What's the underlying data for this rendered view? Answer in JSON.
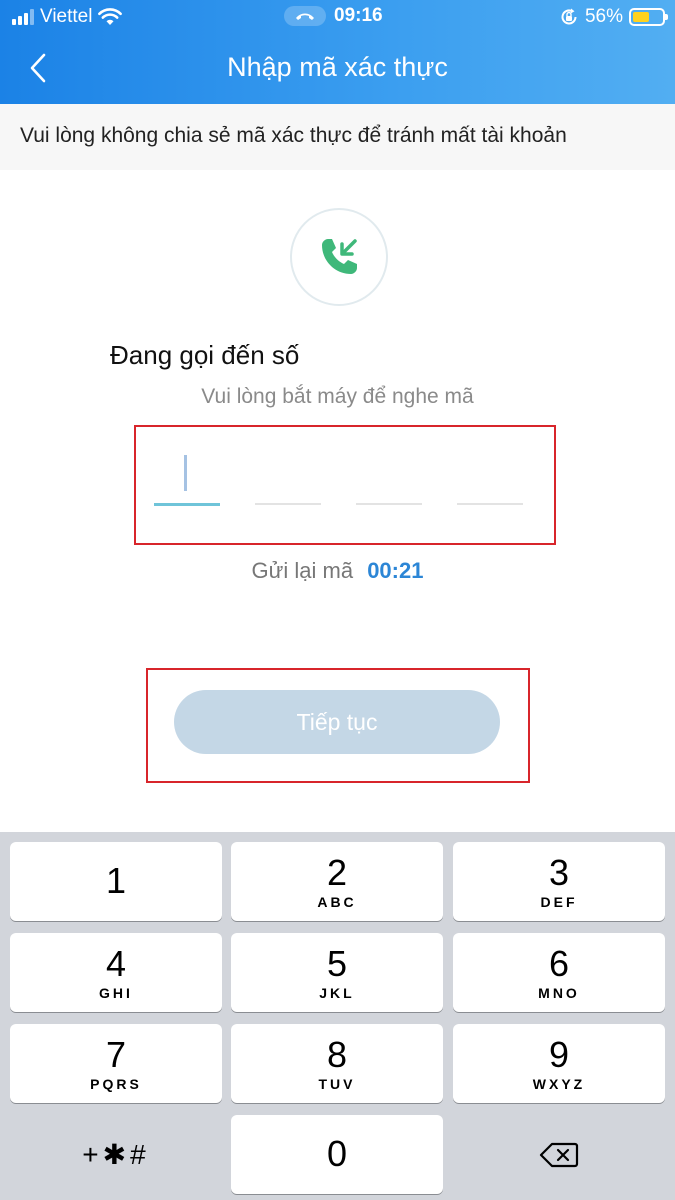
{
  "status_bar": {
    "carrier": "Viettel",
    "time": "09:16",
    "battery": "56%",
    "battery_level": 0.56
  },
  "nav": {
    "title": "Nhập mã xác thực"
  },
  "notice": "Vui lòng không chia sẻ mã xác thực để tránh mất tài khoản",
  "verify": {
    "icon": "incoming-call-icon",
    "calling_label": "Đang gọi đến số",
    "instruction": "Vui lòng bắt máy để nghe mã",
    "otp_digits": [
      "",
      "",
      "",
      ""
    ],
    "resend_label": "Gửi lại mã",
    "resend_timer": "00:21"
  },
  "continue_label": "Tiếp tục",
  "keypad": {
    "keys": [
      {
        "num": "1",
        "letters": ""
      },
      {
        "num": "2",
        "letters": "ABC"
      },
      {
        "num": "3",
        "letters": "DEF"
      },
      {
        "num": "4",
        "letters": "GHI"
      },
      {
        "num": "5",
        "letters": "JKL"
      },
      {
        "num": "6",
        "letters": "MNO"
      },
      {
        "num": "7",
        "letters": "PQRS"
      },
      {
        "num": "8",
        "letters": "TUV"
      },
      {
        "num": "9",
        "letters": "WXYZ"
      },
      {
        "num": "0",
        "letters": ""
      }
    ],
    "symbols": "+✱#"
  },
  "colors": {
    "header_start": "#1b82e6",
    "header_end": "#52aef2",
    "highlight_border": "#d8252b",
    "timer": "#2c86d6",
    "button_disabled": "#c4d7e6",
    "phone_icon": "#3fb87a"
  }
}
